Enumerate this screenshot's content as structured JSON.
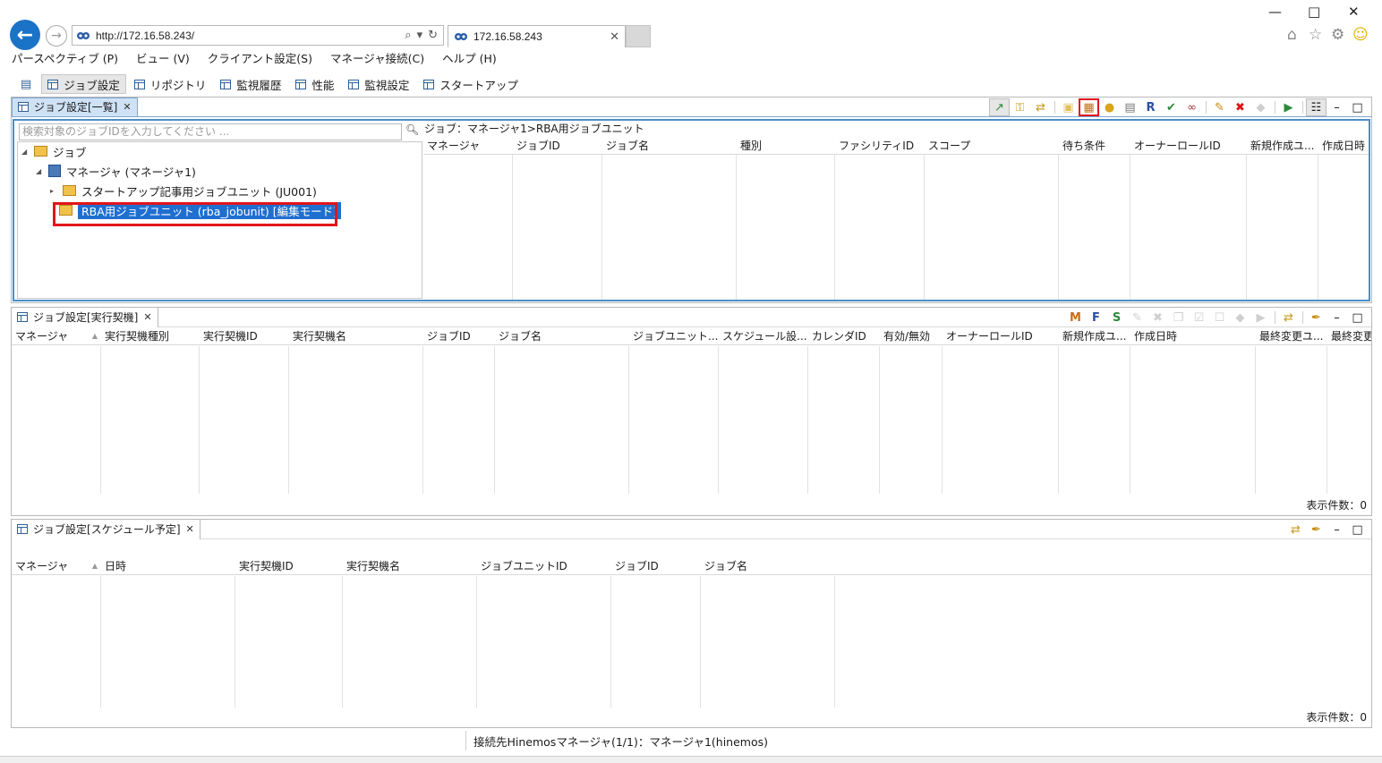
{
  "browser": {
    "url": "http://172.16.58.243/",
    "tab_title": "172.16.58.243",
    "tab_close": "✕"
  },
  "menu": [
    "パースペクティブ (P)",
    "ビュー (V)",
    "クライアント設定(S)",
    "マネージャ接続(C)",
    "ヘルプ (H)"
  ],
  "perspectives": [
    "ジョブ設定",
    "リポジトリ",
    "監視履歴",
    "性能",
    "監視設定",
    "スタートアップ"
  ],
  "job_list_view": {
    "tab_label": "ジョブ設定[一覧]",
    "search_placeholder": "検索対象のジョブIDを入力してください ...",
    "tree": {
      "root": "ジョブ",
      "manager": "マネージャ (マネージャ1)",
      "unit1": "スタートアップ記事用ジョブユニット (JU001)",
      "unit2": "RBA用ジョブユニット (rba_jobunit) [編集モード]"
    },
    "breadcrumb": "ジョブ：マネージャ1>RBA用ジョブユニット",
    "columns": [
      "マネージャ",
      "ジョブID",
      "ジョブ名",
      "種別",
      "ファシリティID",
      "スコープ",
      "待ち条件",
      "オーナーロールID",
      "新規作成ユ...",
      "作成日時"
    ]
  },
  "trigger_view": {
    "tab_label": "ジョブ設定[実行契機]",
    "columns": [
      "マネージャ",
      "実行契機種別",
      "実行契機ID",
      "実行契機名",
      "ジョブID",
      "ジョブ名",
      "ジョブユニット...",
      "スケジュール設...",
      "カレンダID",
      "有効/無効",
      "オーナーロールID",
      "新規作成ユ...",
      "作成日時",
      "最終変更ユ...",
      "最終変更"
    ],
    "count_label": "表示件数：0"
  },
  "schedule_view": {
    "tab_label": "ジョブ設定[スケジュール予定]",
    "columns": [
      "マネージャ",
      "日時",
      "実行契機ID",
      "実行契機名",
      "ジョブユニットID",
      "ジョブID",
      "ジョブ名"
    ],
    "count_label": "表示件数：0"
  },
  "status": {
    "text": "接続先Hinemosマネージャ(1/1)：マネージャ1(hinemos)"
  },
  "colors": {
    "accent": "#1b73c7",
    "highlight_frame": "#e1151b",
    "selection": "#1f6fd0"
  }
}
